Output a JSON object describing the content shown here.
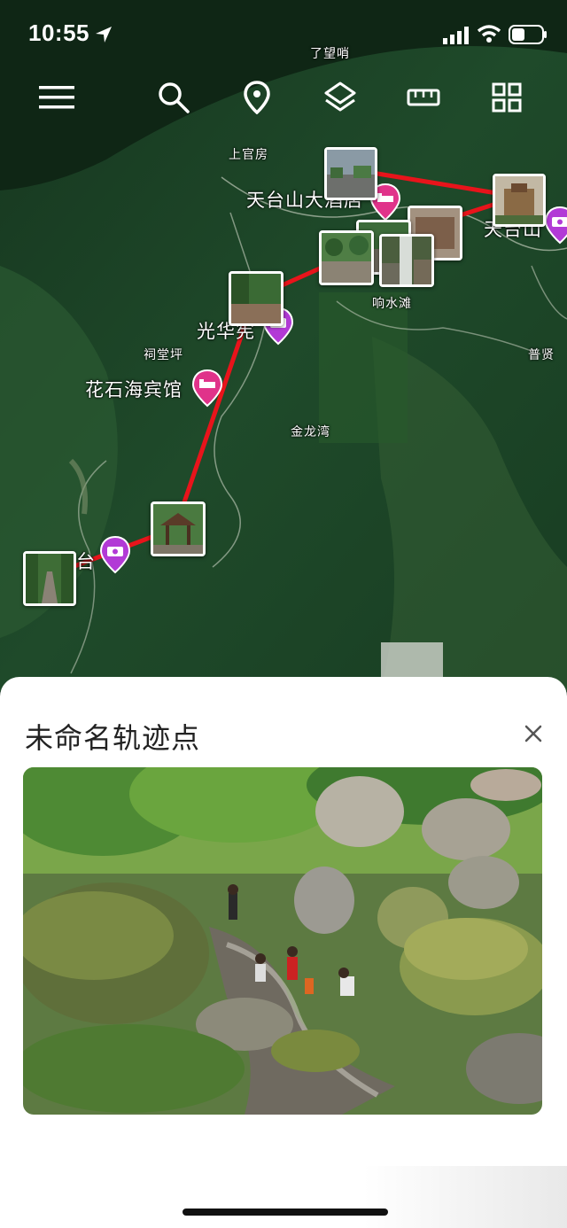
{
  "status_bar": {
    "time": "10:55"
  },
  "map": {
    "labels": {
      "watch": "了望哨",
      "shangguanfang": "上官房",
      "tiantaishan_hotel": "天台山大酒店",
      "tiantaishan": "天台山",
      "xiangshuitan": "响水滩",
      "guanghuaxian": "光华宪",
      "citangping": "祠堂坪",
      "huashihai_hotel": "花石海宾馆",
      "jinlongwan": "金龙湾",
      "puxian": "普贤",
      "tai": "台"
    }
  },
  "sheet": {
    "title": "未命名轨迹点"
  },
  "icons": [
    "menu-icon",
    "search-icon",
    "location-pin-icon",
    "layers-icon",
    "ruler-icon",
    "grid-icon",
    "close-icon",
    "hotel-icon",
    "camera-icon"
  ],
  "colors": {
    "track": "#e8141b",
    "pin": "#b23ad6",
    "pin_hotel": "#e0338a"
  }
}
